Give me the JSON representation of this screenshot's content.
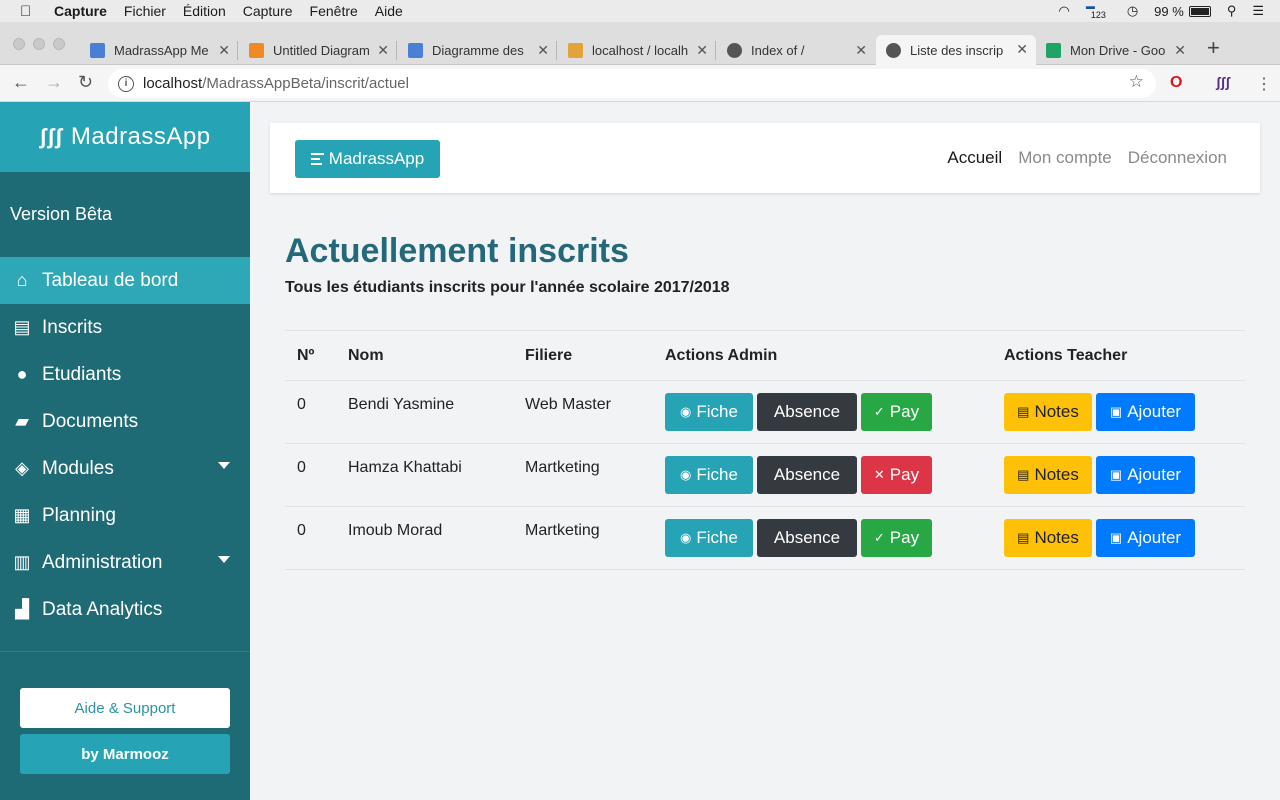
{
  "menubar": {
    "app": "Capture",
    "items": [
      "Fichier",
      "Édition",
      "Capture",
      "Fenêtre",
      "Aide"
    ],
    "battery": "99 %",
    "keyboard": "123"
  },
  "tabs": [
    {
      "title": "MadrassApp Me",
      "color": "#4a7fd6"
    },
    {
      "title": "Untitled Diagram",
      "color": "#f08a24"
    },
    {
      "title": "Diagramme des",
      "color": "#4a7fd6"
    },
    {
      "title": "localhost / localh",
      "color": "#e2a33a"
    },
    {
      "title": "Index of /",
      "color": "#555555"
    },
    {
      "title": "Liste des inscrip",
      "color": "#555555"
    },
    {
      "title": "Mon Drive - Goo",
      "color": "#1fa463"
    }
  ],
  "url": {
    "host": "localhost",
    "path": "/MadrassAppBeta/inscrit/actuel"
  },
  "sidebar": {
    "brand": "MadrassApp",
    "version": "Version Bêta",
    "items": [
      {
        "label": "Tableau de bord",
        "icon": "home-icon"
      },
      {
        "label": "Inscrits",
        "icon": "clipboard-icon"
      },
      {
        "label": "Etudiants",
        "icon": "users-icon"
      },
      {
        "label": "Documents",
        "icon": "folder-icon"
      },
      {
        "label": "Modules",
        "icon": "cubes-icon"
      },
      {
        "label": "Planning",
        "icon": "calendar-icon"
      },
      {
        "label": "Administration",
        "icon": "building-icon"
      },
      {
        "label": "Data Analytics",
        "icon": "chart-icon"
      }
    ],
    "help": "Aide & Support",
    "by": "by Marmooz"
  },
  "topnav": {
    "menu": "MadrassApp",
    "links": [
      "Accueil",
      "Mon compte",
      "Déconnexion"
    ]
  },
  "page": {
    "title": "Actuellement inscrits",
    "subtitle": "Tous les étudiants inscrits pour l'année scolaire 2017/2018"
  },
  "table": {
    "headers": [
      "Nº",
      "Nom",
      "Filiere",
      "Actions Admin",
      "Actions Teacher"
    ],
    "rows": [
      {
        "num": "0",
        "nom": "Bendi Yasmine",
        "filiere": "Web Master",
        "paid": true
      },
      {
        "num": "0",
        "nom": "Hamza Khattabi",
        "filiere": "Martketing",
        "paid": false
      },
      {
        "num": "0",
        "nom": "Imoub Morad",
        "filiere": "Martketing",
        "paid": true
      }
    ],
    "buttons": {
      "fiche": "Fiche",
      "absence": "Absence",
      "pay": "Pay",
      "notes": "Notes",
      "ajouter": "Ajouter"
    }
  }
}
